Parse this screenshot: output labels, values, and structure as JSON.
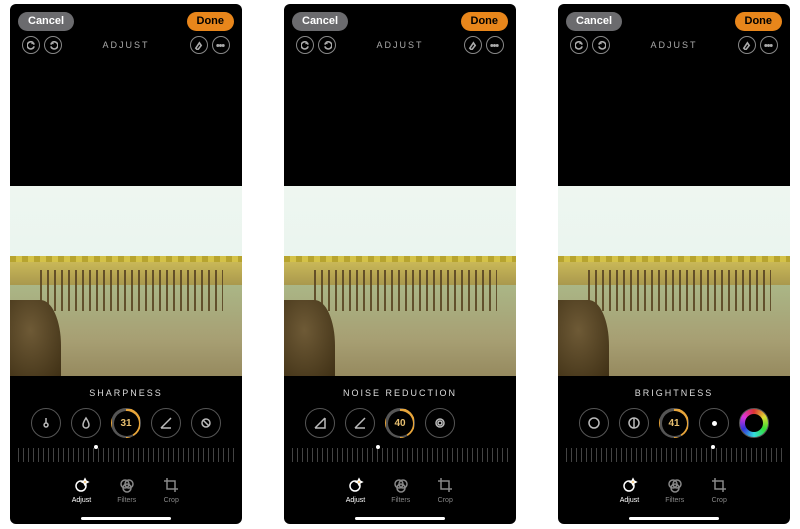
{
  "screens": [
    {
      "cancel": "Cancel",
      "done": "Done",
      "header_mode": "ADJUST",
      "tool_label": "SHARPNESS",
      "value": "31",
      "ruler_pointer_pct": 36,
      "tabs": {
        "adjust": "Adjust",
        "filters": "Filters",
        "crop": "Crop"
      }
    },
    {
      "cancel": "Cancel",
      "done": "Done",
      "header_mode": "ADJUST",
      "tool_label": "NOISE REDUCTION",
      "value": "40",
      "ruler_pointer_pct": 40,
      "tabs": {
        "adjust": "Adjust",
        "filters": "Filters",
        "crop": "Crop"
      }
    },
    {
      "cancel": "Cancel",
      "done": "Done",
      "header_mode": "ADJUST",
      "tool_label": "BRIGHTNESS",
      "value": "41",
      "ruler_pointer_pct": 68,
      "tabs": {
        "adjust": "Adjust",
        "filters": "Filters",
        "crop": "Crop"
      }
    }
  ]
}
